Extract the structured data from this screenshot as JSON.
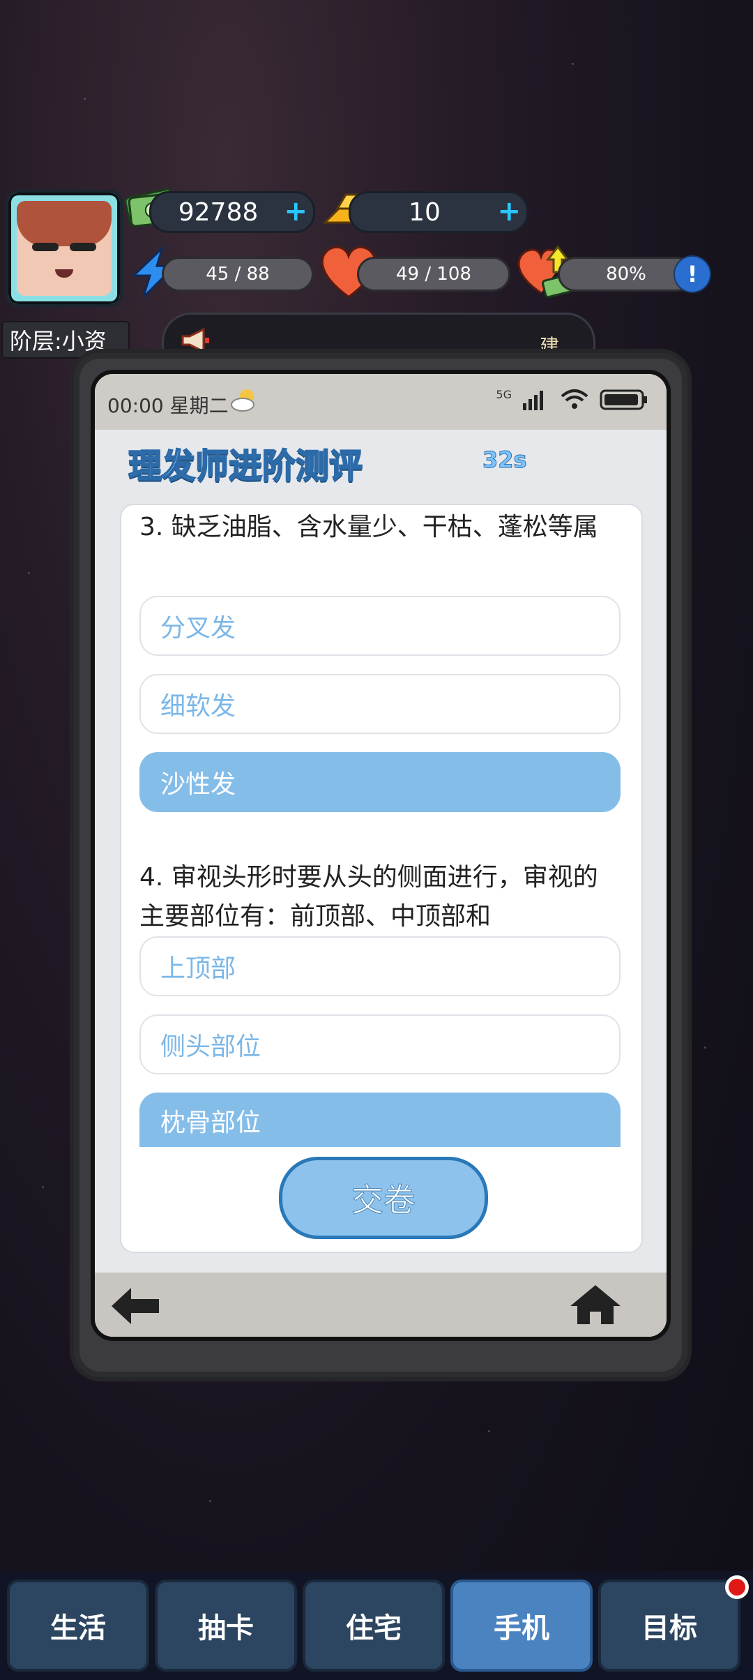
{
  "hud": {
    "cash": "92788",
    "gold": "10",
    "energy": "45 / 88",
    "health": "49 / 108",
    "happiness": "80%",
    "rank": "阶层:小资",
    "marquee_text": "建."
  },
  "phone": {
    "status_time": "00:00 星期二",
    "network_label": "5G",
    "app_title": "理发师进阶测评",
    "timer": "32s",
    "questions": [
      {
        "text": "3. 缺乏油脂、含水量少、干枯、蓬松等属",
        "options": [
          "分叉发",
          "细软发",
          "沙性发"
        ],
        "selected_index": 2
      },
      {
        "text": "4. 审视头形时要从头的侧面进行，审视的主要部位有：前顶部、中顶部和",
        "options": [
          "上顶部",
          "侧头部位",
          "枕骨部位"
        ],
        "selected_index": 2
      }
    ],
    "submit_label": "交卷"
  },
  "tabs": [
    "生活",
    "抽卡",
    "住宅",
    "手机",
    "目标"
  ],
  "active_tab": "手机",
  "colors": {
    "accent": "#85bde9",
    "tab_active": "#4b83c0",
    "tab_default": "#2c4560",
    "notification": "#e01818"
  }
}
